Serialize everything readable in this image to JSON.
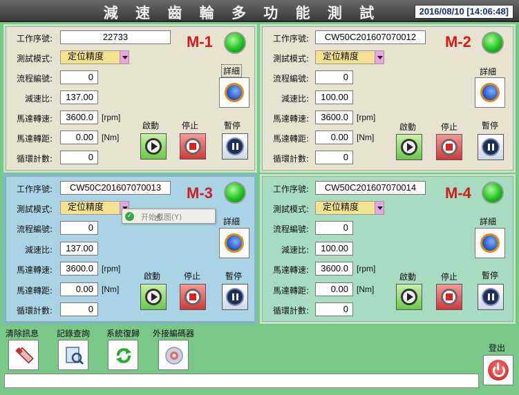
{
  "app": {
    "title": "減 速 齒 輪 多 功 能 測 試 機",
    "datetime": "2016/08/10 [14:06:48]"
  },
  "labels": {
    "serial": "工作序號:",
    "mode": "測試模式:",
    "flow": "流程編號:",
    "ratio": "減速比:",
    "speed": "馬達轉速:",
    "torque": "馬達轉距:",
    "cycle": "循環計數:",
    "unit_rpm": "[rpm]",
    "unit_nm": "[Nm]",
    "start": "啟動",
    "stop": "停止",
    "pause": "暫停",
    "detail": "詳細"
  },
  "machines": [
    {
      "name": "M-1",
      "serial": "22733",
      "mode": "定位精度",
      "flow": "0",
      "ratio": "137.00",
      "speed": "3600.0",
      "torque": "0.00",
      "cycle": "0",
      "status_color": "#1fc21f"
    },
    {
      "name": "M-2",
      "serial": "CW50C201607070012",
      "mode": "定位精度",
      "flow": "0",
      "ratio": "100.00",
      "speed": "3600.0",
      "torque": "0.00",
      "cycle": "0",
      "status_color": "#1fc21f"
    },
    {
      "name": "M-3",
      "serial": "CW50C201607070013",
      "mode": "定位精度",
      "flow": "0",
      "ratio": "137.00",
      "speed": "3600.0",
      "torque": "0.00",
      "cycle": "0",
      "status_color": "#1fc21f"
    },
    {
      "name": "M-4",
      "serial": "CW50C201607070014",
      "mode": "定位精度",
      "flow": "0",
      "ratio": "100.00",
      "speed": "3600.0",
      "torque": "0.00",
      "cycle": "0",
      "status_color": "#1fc21f"
    }
  ],
  "context_menu": {
    "item": "开始截图(Y)"
  },
  "toolbar": {
    "clear_msg": "清除訊息",
    "record_query": "記錄查詢",
    "system_restore": "系統復歸",
    "external_encoder": "外接編碼器",
    "logout": "登出"
  },
  "status_bar": {
    "message": ""
  }
}
